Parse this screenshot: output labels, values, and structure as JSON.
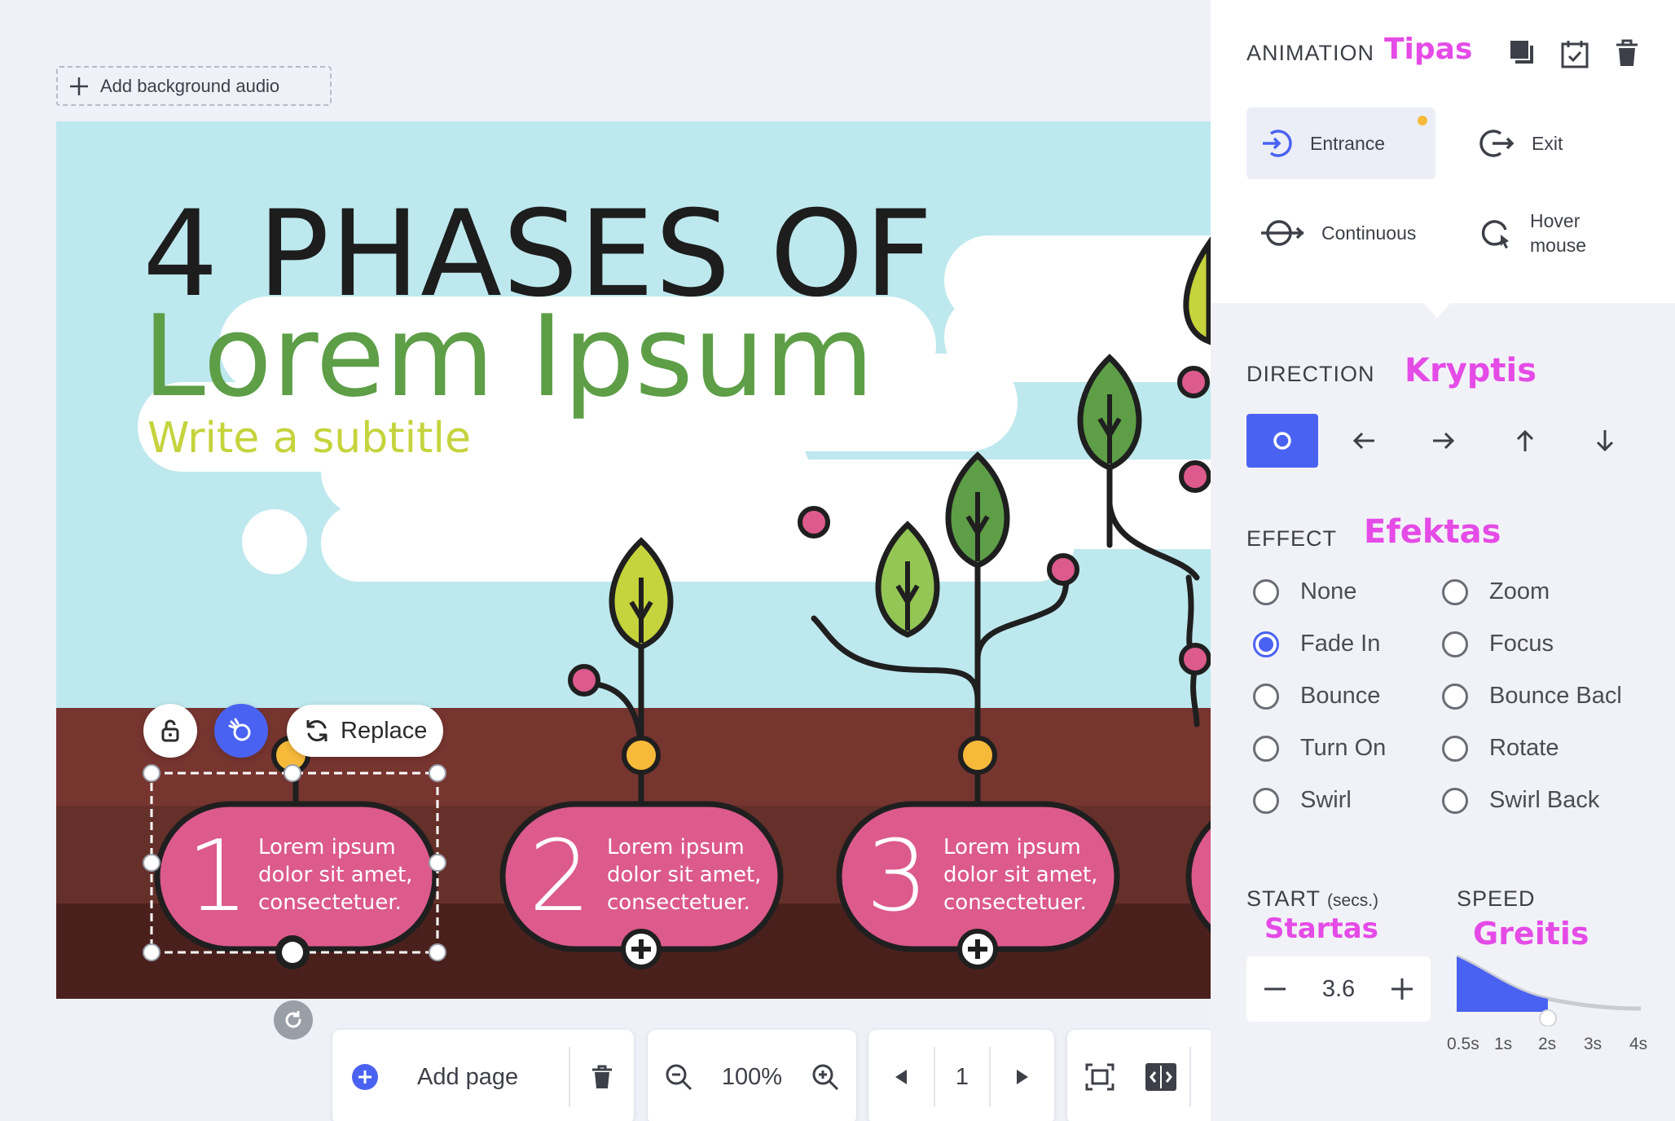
{
  "audio": {
    "label": "Add background audio"
  },
  "slide": {
    "title_line1": "4 PHASES OF",
    "title_line2": "Lorem Ipsum",
    "subtitle": "Write a subtitle",
    "cards": [
      {
        "number": "1",
        "line1": "Lorem ipsum",
        "line2": "dolor sit amet,",
        "line3": "consectetuer."
      },
      {
        "number": "2",
        "line1": "Lorem ipsum",
        "line2": "dolor sit amet,",
        "line3": "consectetuer."
      },
      {
        "number": "3",
        "line1": "Lorem ipsum",
        "line2": "dolor sit amet,",
        "line3": "consectetuer."
      }
    ]
  },
  "element_toolbar": {
    "replace_label": "Replace"
  },
  "bottom_bar": {
    "add_page_label": "Add page",
    "zoom": "100%",
    "page_number": "1"
  },
  "panel": {
    "animation_title": "ANIMATION",
    "animation_note": "Tipas",
    "tabs": [
      {
        "label": "Entrance",
        "active": true
      },
      {
        "label": "Exit"
      },
      {
        "label": "Continuous"
      },
      {
        "label": "Hover mouse"
      }
    ],
    "direction_title": "DIRECTION",
    "direction_note": "Kryptis",
    "effect_title": "EFFECT",
    "effect_note": "Efektas",
    "effects_left": [
      "None",
      "Fade In",
      "Bounce",
      "Turn On",
      "Swirl"
    ],
    "effects_right": [
      "Zoom",
      "Focus",
      "Bounce Bacl",
      "Rotate",
      "Swirl Back"
    ],
    "selected_effect": "Fade In",
    "start_title": "START",
    "start_unit": "(secs.)",
    "start_note": "Startas",
    "start_value": "3.6",
    "speed_title": "SPEED",
    "speed_note": "Greitis",
    "speed_ticks": [
      "0.5s",
      "1s",
      "2s",
      "3s",
      "4s"
    ],
    "speed_selected": "2s"
  },
  "colors": {
    "accent": "#4a62f1",
    "pink_note": "#e54be6",
    "card": "#dc5a8c",
    "soil": "#773530",
    "sky": "#bde8ee"
  }
}
